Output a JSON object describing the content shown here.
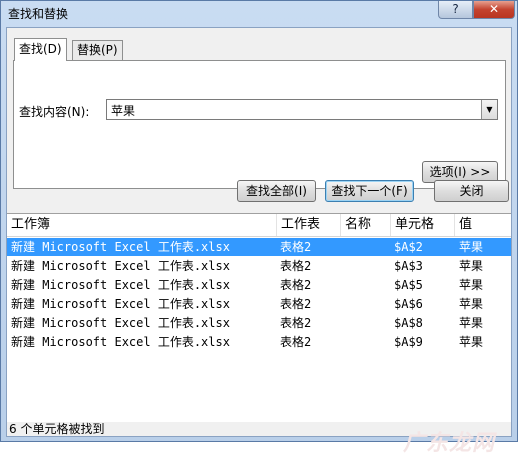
{
  "window": {
    "title": "查找和替换",
    "help": "?",
    "close": "✕"
  },
  "tabs": [
    {
      "label": "查找(D)"
    },
    {
      "label": "替换(P)"
    }
  ],
  "find": {
    "label": "查找内容(N):",
    "value": "苹果",
    "options_button": "选项(I) >>"
  },
  "actions": {
    "find_all": "查找全部(I)",
    "find_next": "查找下一个(F)",
    "close": "关闭"
  },
  "results": {
    "columns": [
      "工作簿",
      "工作表",
      "名称",
      "单元格",
      "值"
    ],
    "rows": [
      [
        "新建 Microsoft Excel 工作表.xlsx",
        "表格2",
        "",
        "$A$2",
        "苹果"
      ],
      [
        "新建 Microsoft Excel 工作表.xlsx",
        "表格2",
        "",
        "$A$3",
        "苹果"
      ],
      [
        "新建 Microsoft Excel 工作表.xlsx",
        "表格2",
        "",
        "$A$5",
        "苹果"
      ],
      [
        "新建 Microsoft Excel 工作表.xlsx",
        "表格2",
        "",
        "$A$6",
        "苹果"
      ],
      [
        "新建 Microsoft Excel 工作表.xlsx",
        "表格2",
        "",
        "$A$8",
        "苹果"
      ],
      [
        "新建 Microsoft Excel 工作表.xlsx",
        "表格2",
        "",
        "$A$9",
        "苹果"
      ]
    ],
    "selected_row": 0
  },
  "status": "6 个单元格被找到",
  "watermark": "广东龙网"
}
